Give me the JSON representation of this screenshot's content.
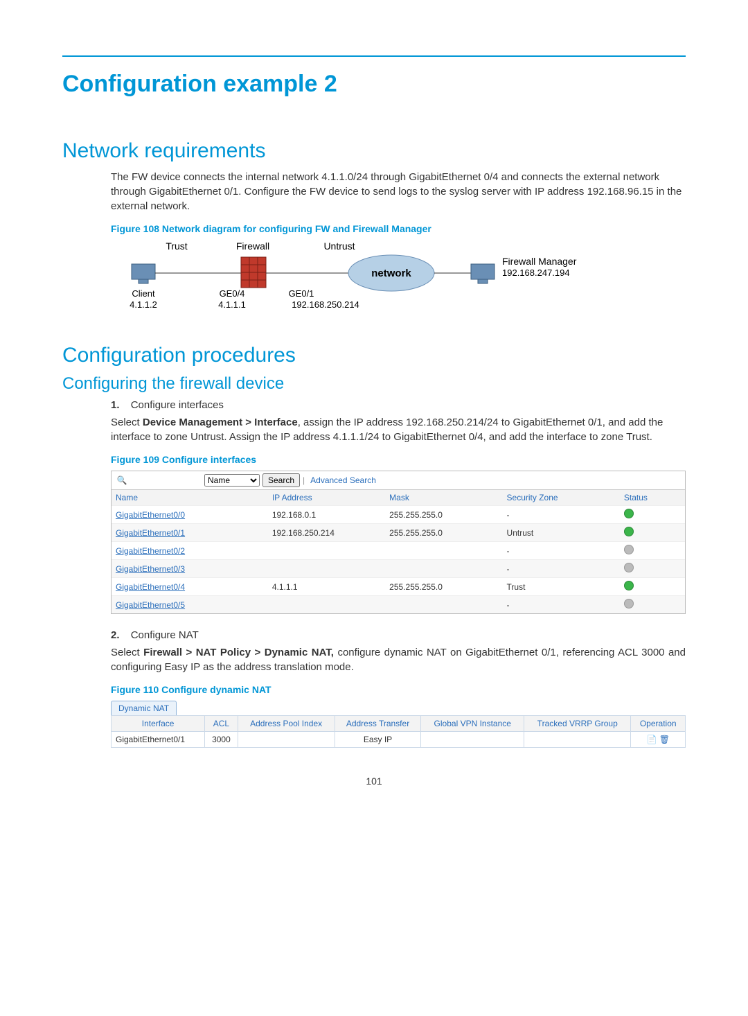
{
  "page_number": "101",
  "h1": "Configuration example 2",
  "h2a": "Network requirements",
  "para1": "The FW device connects the internal network 4.1.1.0/24 through GigabitEthernet 0/4 and connects the external network through GigabitEthernet 0/1. Configure the FW device to send logs to the syslog server with IP address 192.168.96.15 in the external network.",
  "fig108": "Figure 108 Network diagram for configuring FW and Firewall Manager",
  "diagram": {
    "trust": "Trust",
    "firewall": "Firewall",
    "untrust": "Untrust",
    "network": "network",
    "client": "Client",
    "client_ip": "4.1.1.2",
    "ge04": "GE0/4",
    "ge04_ip": "4.1.1.1",
    "ge01": "GE0/1",
    "ge01_ip": "192.168.250.214",
    "mgr": "Firewall Manager",
    "mgr_ip": "192.168.247.194"
  },
  "h2b": "Configuration procedures",
  "h3": "Configuring the firewall device",
  "step1_num": "1.",
  "step1_label": "Configure interfaces",
  "para2a": "Select ",
  "para2b": "Device Management > Interface",
  "para2c": ", assign the IP address 192.168.250.214/24 to GigabitEthernet 0/1, and add the interface to zone Untrust. Assign the IP address 4.1.1.1/24 to GigabitEthernet 0/4, and add the interface to zone Trust.",
  "fig109": "Figure 109 Configure interfaces",
  "search": {
    "field": "Name",
    "button": "Search",
    "advanced": "Advanced Search"
  },
  "if_headers": [
    "Name",
    "IP Address",
    "Mask",
    "Security Zone",
    "Status"
  ],
  "if_rows": [
    {
      "name": "GigabitEthernet0/0",
      "ip": "192.168.0.1",
      "mask": "255.255.255.0",
      "zone": "-",
      "status": "green"
    },
    {
      "name": "GigabitEthernet0/1",
      "ip": "192.168.250.214",
      "mask": "255.255.255.0",
      "zone": "Untrust",
      "status": "green"
    },
    {
      "name": "GigabitEthernet0/2",
      "ip": "",
      "mask": "",
      "zone": "-",
      "status": "gray"
    },
    {
      "name": "GigabitEthernet0/3",
      "ip": "",
      "mask": "",
      "zone": "-",
      "status": "gray"
    },
    {
      "name": "GigabitEthernet0/4",
      "ip": "4.1.1.1",
      "mask": "255.255.255.0",
      "zone": "Trust",
      "status": "green"
    },
    {
      "name": "GigabitEthernet0/5",
      "ip": "",
      "mask": "",
      "zone": "-",
      "status": "gray"
    }
  ],
  "step2_num": "2.",
  "step2_label": "Configure NAT",
  "para3a": "Select ",
  "para3b": "Firewall > NAT Policy > Dynamic NAT,",
  "para3c": " configure dynamic NAT on GigabitEthernet 0/1, referencing ACL 3000 and configuring Easy IP as the address translation mode.",
  "fig110": "Figure 110 Configure dynamic NAT",
  "nat_tab": "Dynamic NAT",
  "nat_headers": [
    "Interface",
    "ACL",
    "Address Pool Index",
    "Address Transfer",
    "Global VPN Instance",
    "Tracked VRRP Group",
    "Operation"
  ],
  "nat_row": {
    "iface": "GigabitEthernet0/1",
    "acl": "3000",
    "pool": "",
    "xfer": "Easy IP",
    "vpn": "",
    "vrrp": ""
  }
}
